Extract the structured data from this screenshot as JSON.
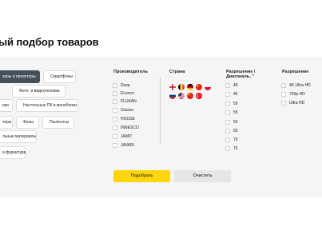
{
  "page": {
    "title": "ый подбор товаров"
  },
  "categories": [
    {
      "label": "зеры и проекторы",
      "active": true
    },
    {
      "label": "Смартфоны",
      "active": false
    },
    {
      "label": "Фото- и видеотехника",
      "active": false
    },
    {
      "label": "рки",
      "active": false
    },
    {
      "label": "Настольные ПК и моноблоки",
      "active": false
    },
    {
      "label": "теры",
      "active": false
    },
    {
      "label": "Фены",
      "active": false
    },
    {
      "label": "Пылесосы",
      "active": false
    },
    {
      "label": "льные материалы",
      "active": false
    },
    {
      "label": "и фурнитура",
      "active": false
    }
  ],
  "filters": {
    "manufacturer": {
      "heading": "Производитель",
      "items": [
        "Dexp",
        "ELenco",
        "FLUKAN",
        "Grasso",
        "HOUSE",
        "INNESCO",
        "JAMIT",
        "JAVARI"
      ]
    },
    "country": {
      "heading": "Страна",
      "flags": [
        {
          "name": "england",
          "color": "#ffffff"
        },
        {
          "name": "belgium",
          "color": "#fdda24"
        },
        {
          "name": "germany",
          "color": "#dd0000"
        },
        {
          "name": "china",
          "color": "#de2910"
        },
        {
          "name": "poland",
          "color": "#dc143c"
        },
        {
          "name": "russia",
          "color": "#0039a6"
        },
        {
          "name": "usa",
          "color": "#3c3b6e"
        },
        {
          "name": "china-2",
          "color": "#de2910"
        },
        {
          "name": "turkey",
          "color": "#e30a17"
        }
      ]
    },
    "diagonal": {
      "heading_line1": "Разрешение /",
      "heading_line2": "Диагональ, \"",
      "items": [
        "40",
        "45",
        "50",
        "55",
        "60",
        "65",
        "70",
        "75"
      ]
    },
    "resolution": {
      "heading": "Разрешение",
      "items": [
        "4K Ultra HD",
        "720p HD",
        "Ultra HD"
      ]
    }
  },
  "actions": {
    "submit_label": "Подобрать",
    "clear_label": "Очистить"
  },
  "colors": {
    "accent": "#ffd60a",
    "chip_active": "#46505a",
    "panel": "#f5f5f5"
  }
}
